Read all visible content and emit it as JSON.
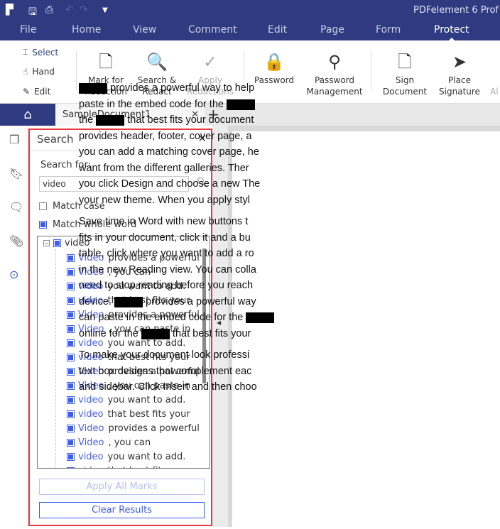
{
  "app": {
    "title": "PDFelement 6 Prof"
  },
  "menu": [
    "File",
    "Home",
    "View",
    "Comment",
    "Edit",
    "Page",
    "Form",
    "Protect"
  ],
  "ribbon": {
    "select": "Select",
    "hand": "Hand",
    "edit": "Edit",
    "buttons": [
      {
        "l1": "Mark for",
        "l2": "Redaction"
      },
      {
        "l1": "Search &",
        "l2": "Redact"
      },
      {
        "l1": "Apply",
        "l2": "Redactions"
      },
      {
        "l1": "Password",
        "l2": ""
      },
      {
        "l1": "Password",
        "l2": "Management"
      },
      {
        "l1": "Sign",
        "l2": "Document"
      },
      {
        "l1": "Place",
        "l2": "Signature"
      }
    ],
    "more": "Al"
  },
  "tabs": {
    "doc": "SampleDocument1"
  },
  "search": {
    "title": "Search",
    "label": "Search for:",
    "value": "video",
    "match_case": "Match case",
    "match_whole": "Match whole word",
    "root": "video",
    "results": [
      {
        "k": "Video",
        "c": "provides a powerful"
      },
      {
        "k": "Video",
        "c": ", you can"
      },
      {
        "k": "video",
        "c": "you want to add."
      },
      {
        "k": "video",
        "c": "that best fits your"
      },
      {
        "k": "Video",
        "c": "provides a powerful"
      },
      {
        "k": "Video",
        "c": ", you can paste in"
      },
      {
        "k": "video",
        "c": "you want to add."
      },
      {
        "k": "video",
        "c": "that best fits your"
      },
      {
        "k": "Video",
        "c": "provides a powerful"
      },
      {
        "k": "Video",
        "c": ", you can paste in"
      },
      {
        "k": "video",
        "c": "you want to add."
      },
      {
        "k": "video",
        "c": "that best fits your"
      },
      {
        "k": "Video",
        "c": "provides a powerful"
      },
      {
        "k": "Video",
        "c": ", you can"
      },
      {
        "k": "video",
        "c": "you want to add."
      },
      {
        "k": "video",
        "c": "that best fits"
      }
    ],
    "apply_all": "Apply All Marks",
    "clear": "Clear Results"
  },
  "document": {
    "paragraphs": [
      [
        "|R| provides a powerful way to help",
        "paste in the embed code for the |R|",
        "the |R| that best fits your document",
        "provides header, footer, cover page, a",
        "you can add a matching cover page, he",
        "want from the different galleries. Ther",
        "you click Design and choose a new The",
        "your new theme. When you apply styl"
      ],
      [
        "Save time in Word with new buttons t",
        "fits in your document, click it and a bu",
        "table, click where you want to add a ro",
        "in the new Reading view. You can colla",
        "need to stop reading before you reach",
        "device. |R| provides a powerful way",
        "can paste in the embed code for the |R|",
        "online for the |R| that best fits your"
      ],
      [
        "To make your document look professi",
        "text box designs that complement eac",
        "and sidebar. Click Insert and then choo"
      ]
    ]
  }
}
